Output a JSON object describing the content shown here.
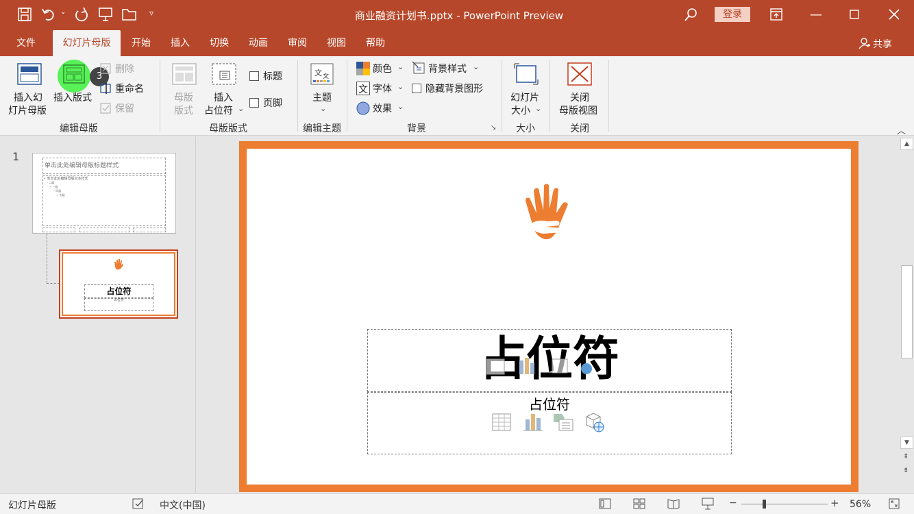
{
  "window": {
    "title": "商业融资计划书.pptx  -  PowerPoint Preview",
    "login_label": "登录",
    "share_label": "共享"
  },
  "tabs": [
    "文件",
    "幻灯片母版",
    "开始",
    "插入",
    "切换",
    "动画",
    "审阅",
    "视图",
    "帮助"
  ],
  "ribbon": {
    "insert_slide_master": [
      "插入幻",
      "灯片母版"
    ],
    "insert_layout": "插入版式",
    "delete": "删除",
    "rename": "重命名",
    "preserve": "保留",
    "group_edit_master": "编辑母版",
    "master_layout": [
      "母版",
      "版式"
    ],
    "insert_placeholder": [
      "插入",
      "占位符"
    ],
    "title_check": "标题",
    "footer_check": "页脚",
    "group_master_layout": "母版版式",
    "themes": "主题",
    "group_edit_theme": "编辑主题",
    "colors": "颜色",
    "fonts": "字体",
    "effects": "效果",
    "background_styles": "背景样式",
    "hide_bg_graphics": "隐藏背景图形",
    "group_background": "背景",
    "slide_size": [
      "幻灯片",
      "大小"
    ],
    "group_size": "大小",
    "close_master": [
      "关闭",
      "母版视图"
    ],
    "group_close": "关闭",
    "step_badge": "3"
  },
  "thumbnails": {
    "slide_number": "1",
    "master_title": "单击此处编辑母版标题样式",
    "master_text": "• 单击此处编辑母版文本样式",
    "master_levels": [
      "– 二级",
      "• 三级",
      "– 四级",
      "» 五级"
    ],
    "layout_title": "占位符",
    "layout_sub": "占位符"
  },
  "slide": {
    "title_placeholder": "占位符",
    "content_placeholder": "占位符",
    "border_color": "#ed7d31"
  },
  "status": {
    "view_name": "幻灯片母版",
    "language": "中文(中国)",
    "zoom": "56%"
  },
  "colors": {
    "accent": "#b7472a",
    "slide_border": "#ed7d31",
    "highlight": "#3cf03c"
  }
}
